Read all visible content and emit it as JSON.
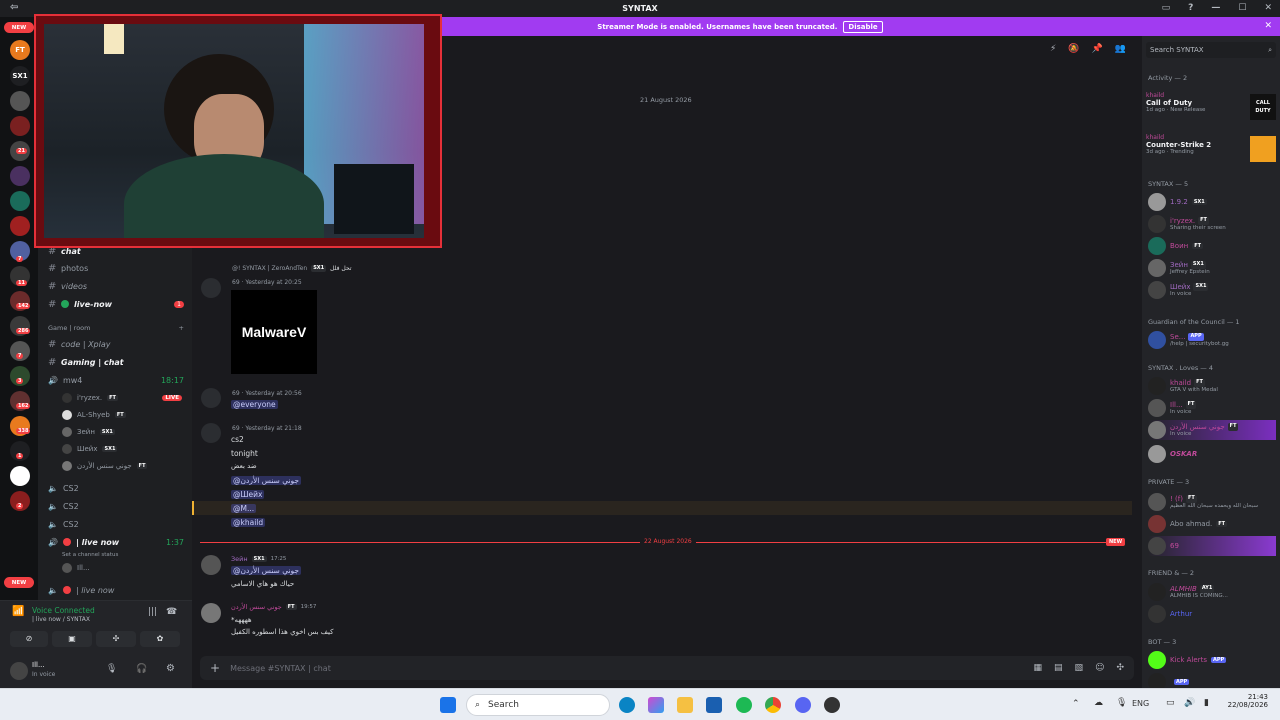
{
  "window": {
    "title": "SYNTAX",
    "back": "⇦"
  },
  "notice": {
    "text": "Streamer Mode is enabled. Usernames have been truncated.",
    "button": "Disable",
    "close": "✕"
  },
  "servers": {
    "new_top": "NEW",
    "new_bottom": "NEW",
    "items": [
      "FT",
      "SX1"
    ],
    "badges": [
      "21",
      "7",
      "11",
      "142",
      "286",
      "7",
      "3",
      "162",
      "338",
      "1",
      "2"
    ]
  },
  "channels": {
    "items_top": [
      "chat",
      "photos",
      "videos",
      "live-now"
    ],
    "live_badge": "1",
    "category": "Game | room",
    "code": "code | Xplay",
    "gaming": "Gaming | chat",
    "voice_mw4": "mw4",
    "voice_mw4_time": "18:17",
    "live_label": "LIVE",
    "users": [
      "i'ryzex.",
      "AL-Shyeb",
      "Зейн",
      "Шейх",
      "جوني سنس الأردن"
    ],
    "user_tags": [
      "FT",
      "FT",
      "SX1",
      "SX1",
      "FT"
    ],
    "cs2": [
      "CS2",
      "CS2",
      "CS2"
    ],
    "live_now": "| live now",
    "live_now_time": "1:37",
    "set_status": "Set a channel status",
    "live_user": "Ill...",
    "live_now2": "| live now"
  },
  "voice": {
    "status": "Voice Connected",
    "channel": "| live now / SYNTAX"
  },
  "user": {
    "name": "Ill...",
    "status": "In voice"
  },
  "chat": {
    "date1": "21 August 2026",
    "date2": "22 August 2026",
    "new_label": "NEW",
    "reply_line": "@! SYNTAX | ZeroAndTen",
    "reply_tag": "SX1",
    "reply_text": "تحل فلل",
    "msg1_name": "69",
    "msg1_time": "Yesterday at 20:25",
    "image_text": "MalwareV",
    "msg2_name": "69",
    "msg2_time": "Yesterday at 20:56",
    "msg2_mention": "@everyone",
    "msg3_name": "69",
    "msg3_time": "Yesterday at 21:18",
    "msg3_lines": [
      "cs2",
      "tonight",
      "ضد بعض"
    ],
    "msg3_mentions": [
      "@جوني سنس الأردن",
      "@Шейх",
      "@M...",
      "@khaild"
    ],
    "msg4_name": "Зейн",
    "msg4_tag": "SX1",
    "msg4_time": "17:25",
    "msg4_mention": "@جوني سنس الأردن",
    "msg4_text": "حياك هو هاي الاسامي",
    "msg5_name": "جوني سنس الأردن",
    "msg5_tag": "FT",
    "msg5_time": "19:57",
    "msg5_line1": "*ههههه",
    "msg5_line2": "كيف بس اخوي هذا اسطوره الكفيل",
    "placeholder": "Message #SYNTAX | chat"
  },
  "members": {
    "search": "Search SYNTAX",
    "activity": "Activity — 2",
    "act1": {
      "user": "khaild",
      "game": "Call of Duty",
      "meta": "1d ago · New Release"
    },
    "act2": {
      "user": "khaild",
      "game": "Counter-Strike 2",
      "meta": "3d ago · Trending"
    },
    "sec_syntax": "SYNTAX — 5",
    "syntax": [
      {
        "name": "1.9.2",
        "tag": "SX1",
        "sub": ""
      },
      {
        "name": "i'ryzex.",
        "tag": "FT",
        "sub": "Sharing their screen"
      },
      {
        "name": "Воин",
        "tag": "FT",
        "sub": ""
      },
      {
        "name": "Зейн",
        "tag": "SX1",
        "sub": "Jeffrey Epstein"
      },
      {
        "name": "Шейх",
        "tag": "SX1",
        "sub": "In voice"
      }
    ],
    "sec_guardian": "Guardian of the Council — 1",
    "guardian": {
      "name": "Se...",
      "tag": "APP",
      "sub": "/help | securitybot.gg"
    },
    "sec_loves": "SYNTAX . Loves — 4",
    "loves": [
      {
        "name": "khaild",
        "tag": "FT",
        "sub": "GTA V with Medal"
      },
      {
        "name": "Ill...",
        "tag": "FT",
        "sub": "In voice"
      },
      {
        "name": "جوني سنس الأردن",
        "tag": "FT",
        "sub": "In voice"
      },
      {
        "name": "OSKAR",
        "tag": "",
        "sub": ""
      }
    ],
    "sec_private": "PRIVATE — 3",
    "private": [
      {
        "name": "! (f)",
        "tag": "FT",
        "sub": "سبحان الله وبحمده سبحان الله العظيم"
      },
      {
        "name": "Abo ahmad.",
        "tag": "FT",
        "sub": ""
      },
      {
        "name": "69",
        "tag": "",
        "sub": ""
      }
    ],
    "sec_friend": "FRIEND & — 2",
    "friend": [
      {
        "name": "ALMHIB",
        "tag": "AY1",
        "sub": "ALMHIB IS COMING..."
      },
      {
        "name": "Arthur",
        "tag": "",
        "sub": ""
      }
    ],
    "sec_bot": "BOT — 3",
    "bot": [
      {
        "name": "Kick Alerts",
        "tag": "APP"
      },
      {
        "name": "",
        "tag": "APP"
      }
    ]
  },
  "taskbar": {
    "search": "Search",
    "lang": "ENG",
    "time": "21:43",
    "date": "22/08/2026"
  },
  "colors": {
    "accent": "#a13bf1",
    "red": "#f23f43",
    "blurple": "#5865f2",
    "green": "#23a55a"
  }
}
